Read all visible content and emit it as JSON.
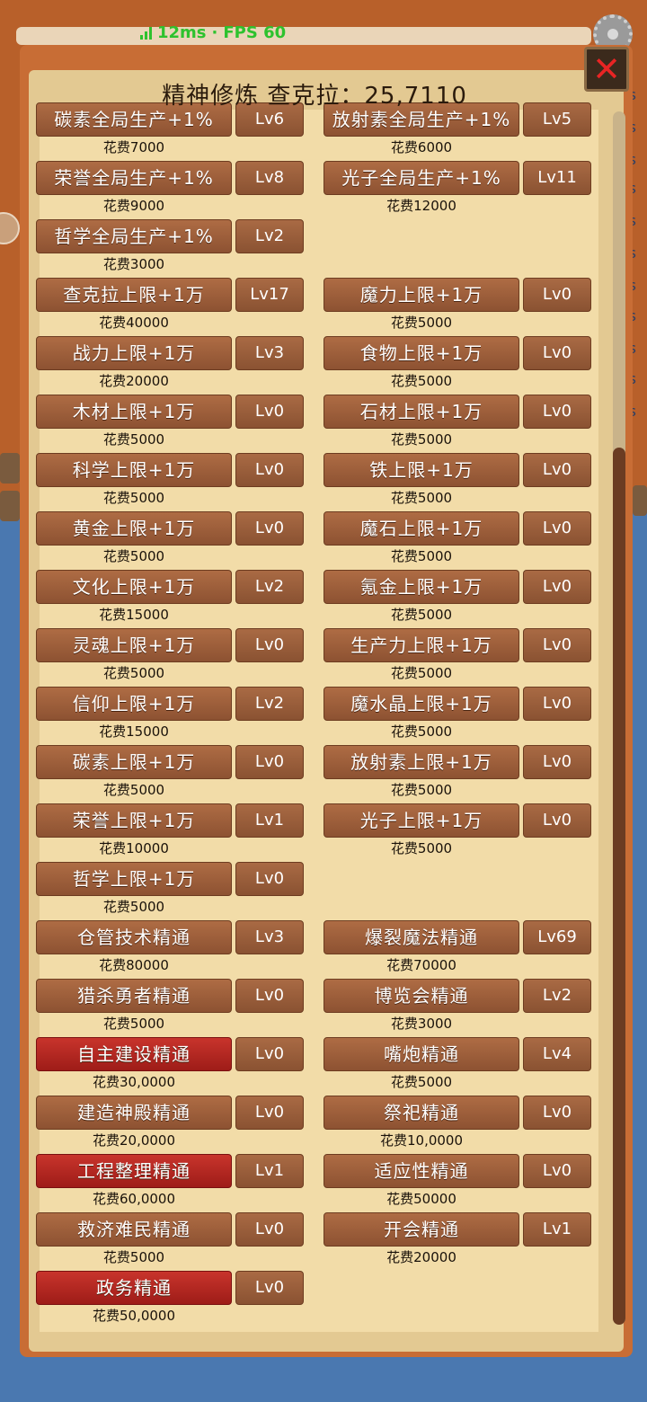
{
  "status": {
    "ping": "12ms",
    "separator": "·",
    "fps": "FPS 60"
  },
  "title": "精神修炼  查克拉：25,7110",
  "close_label": "✕",
  "side_letters": [
    "s",
    "s",
    "s",
    "/s",
    "s",
    "s",
    "s",
    "s",
    "s",
    "s",
    "s",
    "s"
  ],
  "rows": [
    [
      {
        "name": "碳素全局生产+1%",
        "lv": "Lv6",
        "cost": "花费7000",
        "red": false
      },
      {
        "name": "放射素全局生产+1%",
        "lv": "Lv5",
        "cost": "花费6000",
        "red": false
      }
    ],
    [
      {
        "name": "荣誉全局生产+1%",
        "lv": "Lv8",
        "cost": "花费9000",
        "red": false
      },
      {
        "name": "光子全局生产+1%",
        "lv": "Lv11",
        "cost": "花费12000",
        "red": false
      }
    ],
    [
      {
        "name": "哲学全局生产+1%",
        "lv": "Lv2",
        "cost": "花费3000",
        "red": false
      }
    ],
    [
      {
        "name": "查克拉上限+1万",
        "lv": "Lv17",
        "cost": "花费40000",
        "red": false
      },
      {
        "name": "魔力上限+1万",
        "lv": "Lv0",
        "cost": "花费5000",
        "red": false
      }
    ],
    [
      {
        "name": "战力上限+1万",
        "lv": "Lv3",
        "cost": "花费20000",
        "red": false
      },
      {
        "name": "食物上限+1万",
        "lv": "Lv0",
        "cost": "花费5000",
        "red": false
      }
    ],
    [
      {
        "name": "木材上限+1万",
        "lv": "Lv0",
        "cost": "花费5000",
        "red": false
      },
      {
        "name": "石材上限+1万",
        "lv": "Lv0",
        "cost": "花费5000",
        "red": false
      }
    ],
    [
      {
        "name": "科学上限+1万",
        "lv": "Lv0",
        "cost": "花费5000",
        "red": false
      },
      {
        "name": "铁上限+1万",
        "lv": "Lv0",
        "cost": "花费5000",
        "red": false
      }
    ],
    [
      {
        "name": "黄金上限+1万",
        "lv": "Lv0",
        "cost": "花费5000",
        "red": false
      },
      {
        "name": "魔石上限+1万",
        "lv": "Lv0",
        "cost": "花费5000",
        "red": false
      }
    ],
    [
      {
        "name": "文化上限+1万",
        "lv": "Lv2",
        "cost": "花费15000",
        "red": false
      },
      {
        "name": "氪金上限+1万",
        "lv": "Lv0",
        "cost": "花费5000",
        "red": false
      }
    ],
    [
      {
        "name": "灵魂上限+1万",
        "lv": "Lv0",
        "cost": "花费5000",
        "red": false
      },
      {
        "name": "生产力上限+1万",
        "lv": "Lv0",
        "cost": "花费5000",
        "red": false
      }
    ],
    [
      {
        "name": "信仰上限+1万",
        "lv": "Lv2",
        "cost": "花费15000",
        "red": false
      },
      {
        "name": "魔水晶上限+1万",
        "lv": "Lv0",
        "cost": "花费5000",
        "red": false
      }
    ],
    [
      {
        "name": "碳素上限+1万",
        "lv": "Lv0",
        "cost": "花费5000",
        "red": false
      },
      {
        "name": "放射素上限+1万",
        "lv": "Lv0",
        "cost": "花费5000",
        "red": false
      }
    ],
    [
      {
        "name": "荣誉上限+1万",
        "lv": "Lv1",
        "cost": "花费10000",
        "red": false
      },
      {
        "name": "光子上限+1万",
        "lv": "Lv0",
        "cost": "花费5000",
        "red": false
      }
    ],
    [
      {
        "name": "哲学上限+1万",
        "lv": "Lv0",
        "cost": "花费5000",
        "red": false
      }
    ],
    [
      {
        "name": "仓管技术精通",
        "lv": "Lv3",
        "cost": "花费80000",
        "red": false
      },
      {
        "name": "爆裂魔法精通",
        "lv": "Lv69",
        "cost": "花费70000",
        "red": false
      }
    ],
    [
      {
        "name": "猎杀勇者精通",
        "lv": "Lv0",
        "cost": "花费5000",
        "red": false
      },
      {
        "name": "博览会精通",
        "lv": "Lv2",
        "cost": "花费3000",
        "red": false
      }
    ],
    [
      {
        "name": "自主建设精通",
        "lv": "Lv0",
        "cost": "花费30,0000",
        "red": true
      },
      {
        "name": "嘴炮精通",
        "lv": "Lv4",
        "cost": "花费5000",
        "red": false
      }
    ],
    [
      {
        "name": "建造神殿精通",
        "lv": "Lv0",
        "cost": "花费20,0000",
        "red": false
      },
      {
        "name": "祭祀精通",
        "lv": "Lv0",
        "cost": "花费10,0000",
        "red": false
      }
    ],
    [
      {
        "name": "工程整理精通",
        "lv": "Lv1",
        "cost": "花费60,0000",
        "red": true
      },
      {
        "name": "适应性精通",
        "lv": "Lv0",
        "cost": "花费50000",
        "red": false
      }
    ],
    [
      {
        "name": "救济难民精通",
        "lv": "Lv0",
        "cost": "花费5000",
        "red": false
      },
      {
        "name": "开会精通",
        "lv": "Lv1",
        "cost": "花费20000",
        "red": false
      }
    ],
    [
      {
        "name": "政务精通",
        "lv": "Lv0",
        "cost": "花费50,0000",
        "red": true
      }
    ]
  ]
}
